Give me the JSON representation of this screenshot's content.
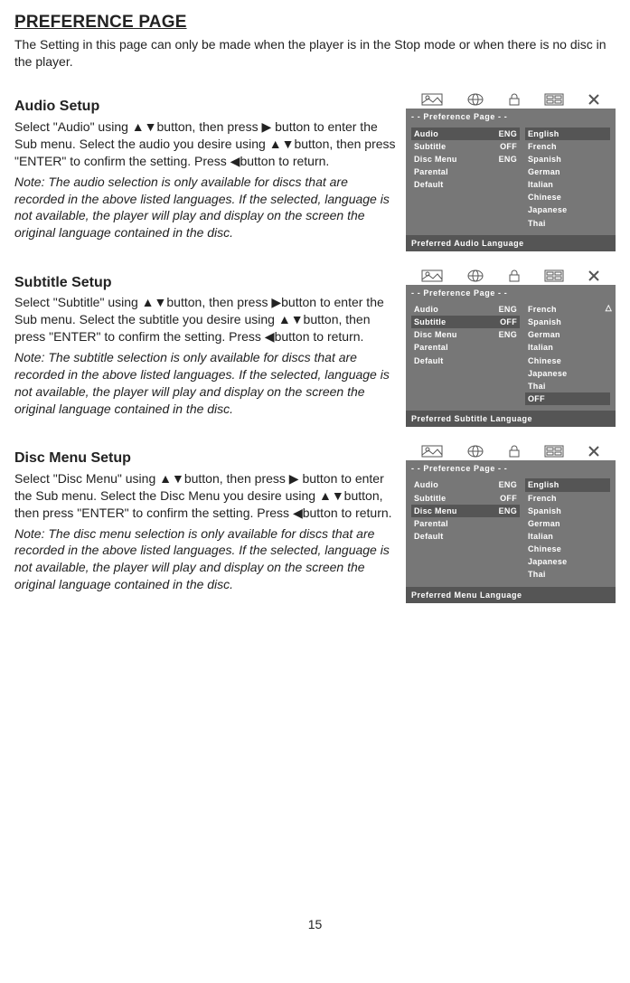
{
  "page": {
    "title": "PREFERENCE PAGE",
    "intro": "The Setting in this page can only be made when the player is in the Stop mode or when there is no disc in the player.",
    "number": "15"
  },
  "arrows": {
    "up": "▲",
    "down": "▼",
    "left": "◀",
    "right": "▶"
  },
  "sections": {
    "audio": {
      "heading": "Audio Setup",
      "text": "Select \"Audio\" using ▲▼button, then press ▶ button to enter the Sub menu. Select the audio you desire using ▲▼button, then press \"ENTER\" to confirm the setting. Press ◀button to return.",
      "note": "Note: The audio selection is only available for discs that are recorded in the above listed languages. If the selected, language is not available, the player will play and display on the screen the original language contained in the disc."
    },
    "subtitle": {
      "heading": "Subtitle Setup",
      "text": "Select \"Subtitle\" using ▲▼button, then press ▶button to enter the Sub menu. Select the subtitle you desire using ▲▼button, then press \"ENTER\" to confirm the setting. Press ◀button to return.",
      "note": "Note: The subtitle selection is only available for discs that are recorded in the above listed languages. If the selected, language is not available, the player will play and display on the screen the original language contained in the disc."
    },
    "discmenu": {
      "heading": "Disc Menu Setup",
      "text": "Select \"Disc Menu\" using ▲▼button, then press ▶ button to enter the Sub menu. Select the Disc Menu you desire using ▲▼button, then press \"ENTER\" to confirm the setting. Press ◀button to return.",
      "note": "Note: The disc menu selection is only available for discs that are recorded in the above listed languages. If the selected, language is not available, the player will play and display on the screen the original language contained in the disc."
    }
  },
  "osd_common": {
    "tab_title": "- -  Preference Page  - -",
    "rows": {
      "audio": "Audio",
      "subtitle": "Subtitle",
      "discmenu": "Disc Menu",
      "parental": "Parental",
      "default": "Default"
    },
    "values": {
      "eng": "ENG",
      "off": "OFF"
    }
  },
  "osd_audio": {
    "footer": "Preferred Audio Language",
    "langs": [
      "English",
      "French",
      "Spanish",
      "German",
      "Italian",
      "Chinese",
      "Japanese",
      "Thai"
    ],
    "selected_left": "audio",
    "selected_right": "English"
  },
  "osd_subtitle": {
    "footer": "Preferred Subtitle Language",
    "langs": [
      "French",
      "Spanish",
      "German",
      "Italian",
      "Chinese",
      "Japanese",
      "Thai",
      "OFF"
    ],
    "selected_left": "subtitle",
    "selected_right": "OFF",
    "scroll_indicator": "△"
  },
  "osd_discmenu": {
    "footer": "Preferred Menu Language",
    "langs": [
      "English",
      "French",
      "Spanish",
      "German",
      "Italian",
      "Chinese",
      "Japanese",
      "Thai"
    ],
    "selected_left": "discmenu",
    "selected_right": "English"
  }
}
